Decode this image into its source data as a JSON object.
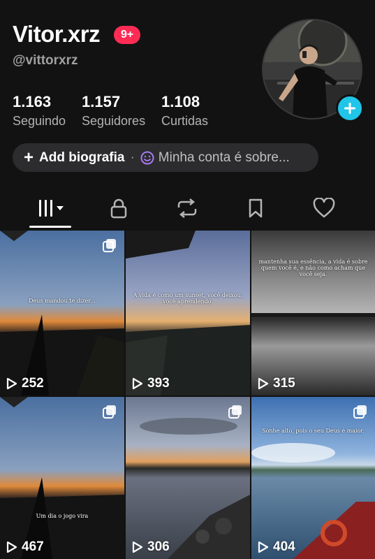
{
  "profile": {
    "display_name": "Vitor.xrz",
    "notification_badge": "9+",
    "handle": "@vittorxrz",
    "avatar_icon": "profile-photo",
    "add_icon": "plus-icon"
  },
  "stats": [
    {
      "value": "1.163",
      "label": "Seguindo"
    },
    {
      "value": "1.157",
      "label": "Seguidores"
    },
    {
      "value": "1.108",
      "label": "Curtidas"
    }
  ],
  "bio": {
    "add_label": "Add biografia",
    "separator": "·",
    "prompt": "Minha conta é sobre..."
  },
  "tabs": [
    {
      "name": "videos",
      "icon": "grid-icon",
      "active": true
    },
    {
      "name": "private",
      "icon": "lock-icon"
    },
    {
      "name": "reposts",
      "icon": "repost-icon"
    },
    {
      "name": "favorites",
      "icon": "bookmark-icon"
    },
    {
      "name": "liked",
      "icon": "heart-icon"
    }
  ],
  "videos": [
    {
      "views": "252",
      "caption": "Deus mandou te dizer...",
      "multi": true
    },
    {
      "views": "393",
      "caption": "A vida é como um sunset, você deixou, você aprendendo.",
      "multi": false
    },
    {
      "views": "315",
      "caption": "mantenha sua essência, a vida é sobre quem você é, e não como acham que você seja.",
      "multi": false
    },
    {
      "views": "467",
      "caption": "Um dia o jogo vira",
      "multi": true
    },
    {
      "views": "306",
      "caption": "",
      "multi": true
    },
    {
      "views": "404",
      "caption": "Sonhe alto, pois o seu Deus é maior.",
      "multi": true
    }
  ],
  "colors": {
    "background": "#121212",
    "badge": "#fe2c55",
    "add_button": "#20c5e8",
    "bio_pill": "#2c2c2e",
    "emoji_accent": "#a77bf3"
  }
}
